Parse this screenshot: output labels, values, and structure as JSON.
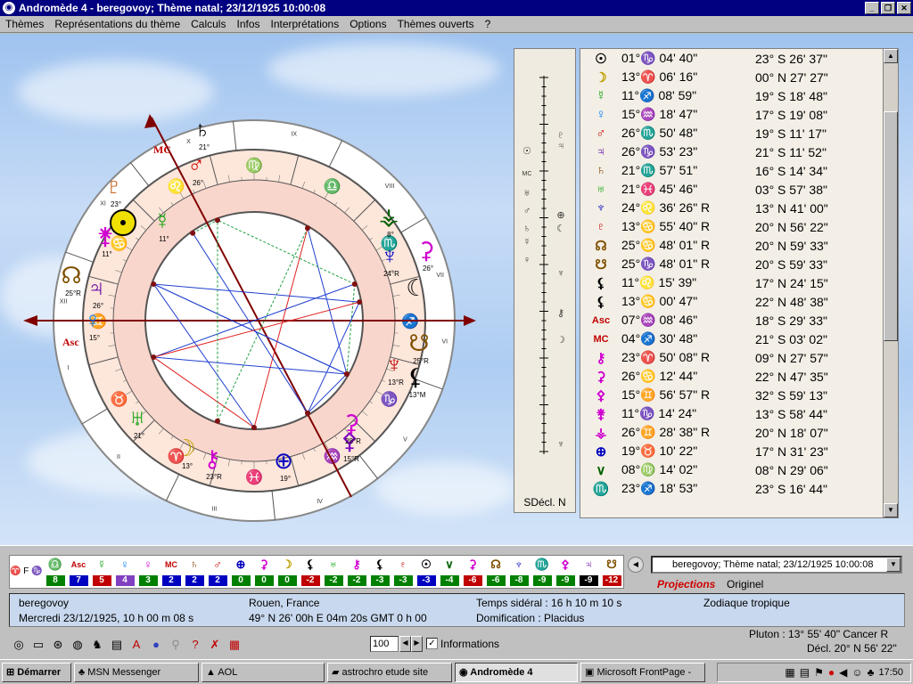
{
  "window": {
    "title": "Andromède 4 - beregovoy; Thème natal; 23/12/1925 10:00:08",
    "buttons": [
      "_",
      "❐",
      "✕"
    ]
  },
  "menu": [
    "Thèmes",
    "Représentations du thème",
    "Calculs",
    "Infos",
    "Interprétations",
    "Options",
    "Thèmes ouverts",
    "?"
  ],
  "wheel": {
    "house_numbers": [
      "I",
      "II",
      "III",
      "IV",
      "V",
      "VI",
      "VII",
      "VIII",
      "IX",
      "X",
      "XI",
      "XII"
    ],
    "angle_labels": [
      "Asc",
      "MC"
    ],
    "zodiac": [
      "♈",
      "♉",
      "♊",
      "♋",
      "♌",
      "♍",
      "♎",
      "♏",
      "♐",
      "♑",
      "♒",
      "♓"
    ],
    "outer_planets": [
      {
        "glyph": "☉",
        "deg": "",
        "color": "#000000"
      },
      {
        "glyph": "♄",
        "deg": "21°",
        "color": "#000000"
      },
      {
        "glyph": "♂",
        "deg": "26°",
        "color": "#d00000"
      },
      {
        "glyph": "☿",
        "deg": "11°",
        "color": "#00a000"
      },
      {
        "glyph": "♇",
        "deg": "23°",
        "color": "#c05000"
      },
      {
        "glyph": "⚵",
        "deg": "11°",
        "color": "#d000d0"
      },
      {
        "glyph": "☊",
        "deg": "25°R",
        "color": "#805000"
      },
      {
        "glyph": "♃",
        "deg": "26°",
        "color": "#6000a0"
      },
      {
        "glyph": "♀",
        "deg": "15°",
        "color": "#0080ff"
      },
      {
        "glyph": "♅",
        "deg": "21°",
        "color": "#00a000"
      },
      {
        "glyph": "☽",
        "deg": "13°",
        "color": "#c0a000"
      },
      {
        "glyph": "⚷",
        "deg": "23°R",
        "color": "#d000d0"
      },
      {
        "glyph": "⊕",
        "deg": "19°",
        "color": "#0000c0"
      },
      {
        "glyph": "⚴",
        "deg": "15°R",
        "color": "#8000c0"
      },
      {
        "glyph": "⚳",
        "deg": "28°R",
        "color": "#d000d0"
      },
      {
        "glyph": "♆",
        "deg": "13°R",
        "color": "#c00000"
      },
      {
        "glyph": "☋",
        "deg": "25°R",
        "color": "#805000"
      },
      {
        "glyph": "⚸",
        "deg": "13°M",
        "color": "#000000"
      },
      {
        "glyph": "☾",
        "deg": "",
        "color": "#000000"
      },
      {
        "glyph": "♆",
        "deg": "24°R",
        "color": "#0000c0"
      },
      {
        "glyph": "⚳",
        "deg": "26°",
        "color": "#d000d0"
      },
      {
        "glyph": "⚶",
        "deg": "8°",
        "color": "#006000"
      }
    ]
  },
  "declination_panel": {
    "label": "SDécl. N",
    "glyphs": [
      "☉",
      "♇",
      "♃",
      "MC",
      "♅",
      "♂",
      "♄",
      "☿",
      "♀",
      "⊕",
      "☾",
      "♆",
      "⚷",
      "☽",
      "♆"
    ]
  },
  "positions": [
    {
      "glyph": "☉",
      "color": "#000000",
      "lon": "01°♑ 04' 40\"",
      "lat": "23° S 26' 37\""
    },
    {
      "glyph": "☽",
      "color": "#c0a000",
      "lon": "13°♈ 06' 16\"",
      "lat": "00° N 27' 27\""
    },
    {
      "glyph": "☿",
      "color": "#00a000",
      "lon": "11°♐ 08' 59\"",
      "lat": "19° S 18' 48\""
    },
    {
      "glyph": "♀",
      "color": "#0080ff",
      "lon": "15°♒ 18' 47\"",
      "lat": "17° S 19' 08\""
    },
    {
      "glyph": "♂",
      "color": "#d00000",
      "lon": "26°♏ 50' 48\"",
      "lat": "19° S 11' 17\""
    },
    {
      "glyph": "♃",
      "color": "#6000a0",
      "lon": "26°♑ 53' 23\"",
      "lat": "21° S 11' 52\""
    },
    {
      "glyph": "♄",
      "color": "#804000",
      "lon": "21°♏ 57' 51\"",
      "lat": "16° S 14' 34\""
    },
    {
      "glyph": "♅",
      "color": "#00a000",
      "lon": "21°♓ 45' 46\"",
      "lat": "03° S 57' 38\""
    },
    {
      "glyph": "♆",
      "color": "#0000c0",
      "lon": "24°♌ 36' 26\" R",
      "lat": "13° N 41' 00\""
    },
    {
      "glyph": "♇",
      "color": "#c00000",
      "lon": "13°♋ 55' 40\" R",
      "lat": "20° N 56' 22\""
    },
    {
      "glyph": "☊",
      "color": "#805000",
      "lon": "25°♋ 48' 01\" R",
      "lat": "20° N 59' 33\""
    },
    {
      "glyph": "☋",
      "color": "#805000",
      "lon": "25°♑ 48' 01\" R",
      "lat": "20° S 59' 33\""
    },
    {
      "glyph": "⚸",
      "color": "#000000",
      "lon": "11°♌ 15' 39\"",
      "lat": "17° N 24' 15\""
    },
    {
      "glyph": "⚸",
      "color": "#000000",
      "lon": "13°♋ 00' 47\"",
      "lat": "22° N 48' 38\""
    },
    {
      "glyph": "Asc",
      "color": "#c00000",
      "lon": "07°♒ 08' 46\"",
      "lat": "18° S 29' 33\""
    },
    {
      "glyph": "MC",
      "color": "#c00000",
      "lon": "04°♐ 30' 48\"",
      "lat": "21° S 03' 02\""
    },
    {
      "glyph": "⚷",
      "color": "#d000d0",
      "lon": "23°♈ 50' 08\" R",
      "lat": "09° N 27' 57\""
    },
    {
      "glyph": "⚳",
      "color": "#d000d0",
      "lon": "26°♋ 12' 44\"",
      "lat": "22° N 47' 35\""
    },
    {
      "glyph": "⚴",
      "color": "#d000d0",
      "lon": "15°♊ 56' 57\" R",
      "lat": "32° S 59' 13\""
    },
    {
      "glyph": "⚵",
      "color": "#d000d0",
      "lon": "11°♑ 14' 24\"",
      "lat": "13° S 58' 44\""
    },
    {
      "glyph": "⚶",
      "color": "#d000d0",
      "lon": "26°♊ 28' 38\" R",
      "lat": "20° N 18' 07\""
    },
    {
      "glyph": "⊕",
      "color": "#0000c0",
      "lon": "19°♉ 10' 22\"",
      "lat": "17° N 31' 23\""
    },
    {
      "glyph": "∨",
      "color": "#006000",
      "lon": "08°♍ 14' 02\"",
      "lat": "08° N 29' 06\""
    },
    {
      "glyph": "♏",
      "color": "#c05000",
      "lon": "23°♐ 18' 53\"",
      "lat": "23° S 16' 44\""
    }
  ],
  "strip": {
    "settings_glyphs": "♈ F ♑ ♅",
    "cells": [
      {
        "glyph": "♎",
        "num": "8",
        "color": "#008000",
        "gcolor": "#0060c0"
      },
      {
        "glyph": "Asc",
        "num": "7",
        "color": "#0000c0",
        "gcolor": "#c00000"
      },
      {
        "glyph": "☿",
        "num": "5",
        "color": "#c00000",
        "gcolor": "#00a000"
      },
      {
        "glyph": "♀",
        "num": "4",
        "color": "#8040c0",
        "gcolor": "#0080ff"
      },
      {
        "glyph": "♀",
        "num": "3",
        "color": "#008000",
        "gcolor": "#d000d0"
      },
      {
        "glyph": "MC",
        "num": "2",
        "color": "#0000c0",
        "gcolor": "#c00000"
      },
      {
        "glyph": "♄",
        "num": "2",
        "color": "#0000c0",
        "gcolor": "#804000"
      },
      {
        "glyph": "♂",
        "num": "2",
        "color": "#0000c0",
        "gcolor": "#d00000"
      },
      {
        "glyph": "⊕",
        "num": "0",
        "color": "#008000",
        "gcolor": "#0000c0"
      },
      {
        "glyph": "⚳",
        "num": "0",
        "color": "#008000",
        "gcolor": "#d000d0"
      },
      {
        "glyph": "☽",
        "num": "0",
        "color": "#008000",
        "gcolor": "#c0a000"
      },
      {
        "glyph": "⚸",
        "num": "-2",
        "color": "#c00000",
        "gcolor": "#000000"
      },
      {
        "glyph": "♅",
        "num": "-2",
        "color": "#008000",
        "gcolor": "#00a000"
      },
      {
        "glyph": "⚷",
        "num": "-2",
        "color": "#008000",
        "gcolor": "#d000d0"
      },
      {
        "glyph": "⚸",
        "num": "-3",
        "color": "#008000",
        "gcolor": "#000000"
      },
      {
        "glyph": "♇",
        "num": "-3",
        "color": "#008000",
        "gcolor": "#c00000"
      },
      {
        "glyph": "☉",
        "num": "-3",
        "color": "#0000c0",
        "gcolor": "#000000"
      },
      {
        "glyph": "∨",
        "num": "-4",
        "color": "#008000",
        "gcolor": "#006000"
      },
      {
        "glyph": "⚳",
        "num": "-6",
        "color": "#c00000",
        "gcolor": "#d000d0"
      },
      {
        "glyph": "☊",
        "num": "-6",
        "color": "#008000",
        "gcolor": "#805000"
      },
      {
        "glyph": "♆",
        "num": "-8",
        "color": "#008000",
        "gcolor": "#0000c0"
      },
      {
        "glyph": "♏",
        "num": "-9",
        "color": "#008000",
        "gcolor": "#c05000"
      },
      {
        "glyph": "⚴",
        "num": "-9",
        "color": "#008000",
        "gcolor": "#d000d0"
      },
      {
        "glyph": "♃",
        "num": "-9",
        "color": "#000000",
        "gcolor": "#6000a0"
      },
      {
        "glyph": "☋",
        "num": "-12",
        "color": "#c00000",
        "gcolor": "#805000"
      }
    ]
  },
  "chart_selector": "beregovoy; Thème natal; 23/12/1925 10:00:08",
  "projections_label": "Projections",
  "origin_label": "Originel",
  "info": {
    "name": "beregovoy",
    "date": "Mercredi 23/12/1925, 10 h 00 m 08 s",
    "place": "Rouen, France",
    "coords": "49° N 26' 00h E 04m 20s GMT 0 h 00",
    "sidereal": "Temps sidéral : 16 h  10 m  10 s",
    "domif": "Domification :  Placidus",
    "zodiac": "Zodiaque tropique"
  },
  "zoom": "100",
  "informations_label": "Informations",
  "pluto_line": "Pluton  :  13° 55' 40\"  Cancer R",
  "decl_line": "Décl.  20° N 56' 22\"",
  "taskbar": {
    "start": "Démarrer",
    "items": [
      "MSN Messenger",
      "AOL",
      "astrochro etude site",
      "Andromède 4",
      "Microsoft FrontPage -"
    ],
    "clock": "17:50"
  }
}
